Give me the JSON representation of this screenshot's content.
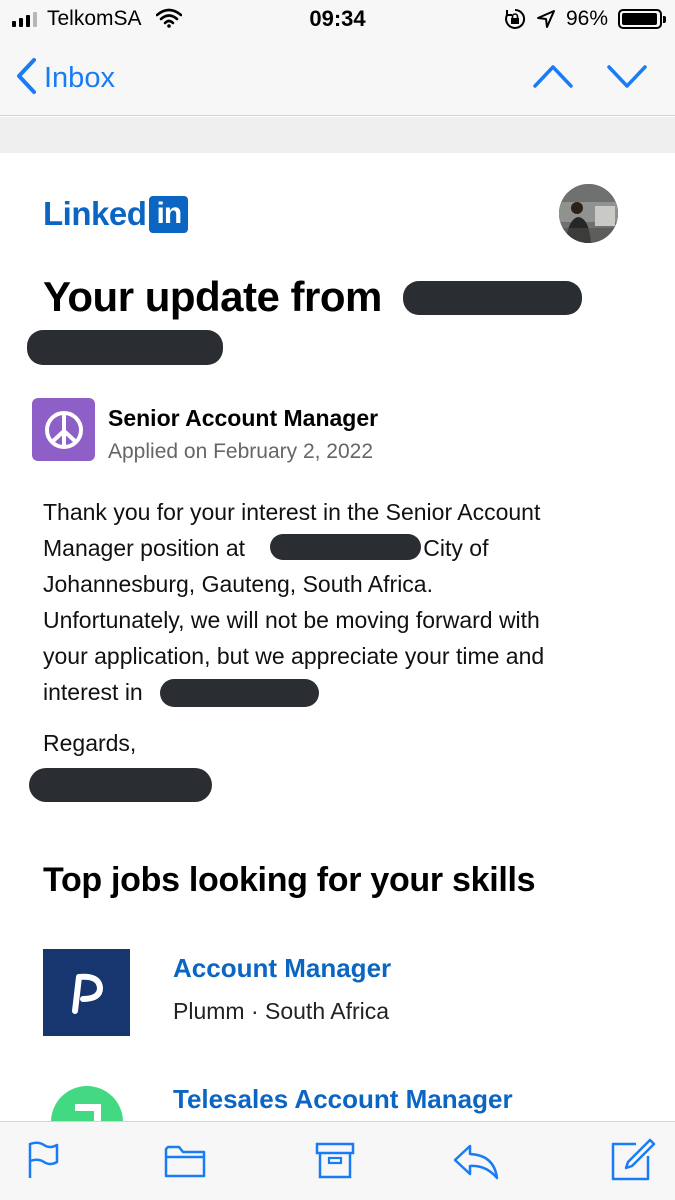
{
  "status_bar": {
    "carrier": "TelkomSA",
    "time": "09:34",
    "battery_percent": "96%",
    "battery_level": 0.96,
    "signal_bars_filled": 3,
    "signal_bars_total": 4
  },
  "nav": {
    "back_label": "Inbox",
    "accent_color": "#1a7cf5",
    "icons": [
      "chevron-left-icon",
      "chevron-up-icon",
      "chevron-down-icon"
    ]
  },
  "email": {
    "brand_logo_text": "Linked",
    "brand_logo_box": "in",
    "headline": "Your update from",
    "application": {
      "job_title": "Senior Account Manager",
      "applied_text": "Applied on February 2, 2022"
    },
    "body": {
      "line1": "Thank you for your interest in the Senior Account",
      "line2_a": "Manager position at",
      "line2_b": "in City of",
      "line3": "Johannesburg, Gauteng, South Africa.",
      "line4": "Unfortunately, we will not be moving forward with",
      "line5": "your application, but we appreciate your time and",
      "line6": "interest in"
    },
    "regards": "Regards,",
    "section_title": "Top jobs looking for your skills",
    "recommended_jobs": [
      {
        "title": "Account Manager",
        "subtitle": "Plumm · South Africa"
      },
      {
        "title": "Telesales Account Manager"
      }
    ]
  },
  "toolbar": {
    "icons": [
      "flag-icon",
      "folder-icon",
      "archive-icon",
      "reply-icon",
      "compose-icon"
    ]
  }
}
